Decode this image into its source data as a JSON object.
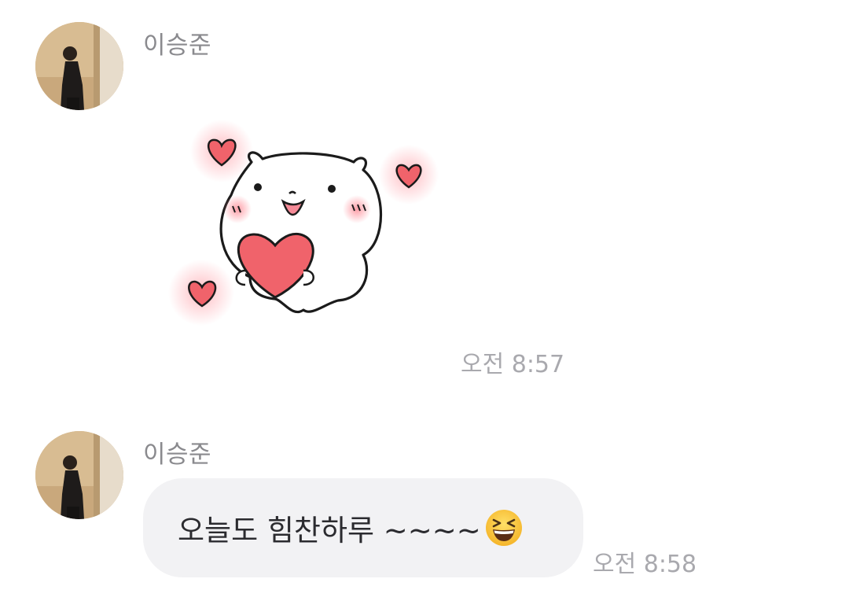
{
  "messages": [
    {
      "sender": "이승준",
      "type": "sticker",
      "sticker": "white-bear-holding-heart-sticker",
      "time": "오전 8:57"
    },
    {
      "sender": "이승준",
      "type": "text",
      "text": "오늘도 힘찬하루 ~~~~",
      "emoji": "grinning-squinting-face-emoji",
      "time": "오전 8:58"
    }
  ],
  "colors": {
    "bubble_background": "#f2f2f4",
    "name_text": "#8a8a8e",
    "time_text": "#a9a9ae",
    "message_text": "#2b2b2f",
    "heart": "#f0636b"
  }
}
